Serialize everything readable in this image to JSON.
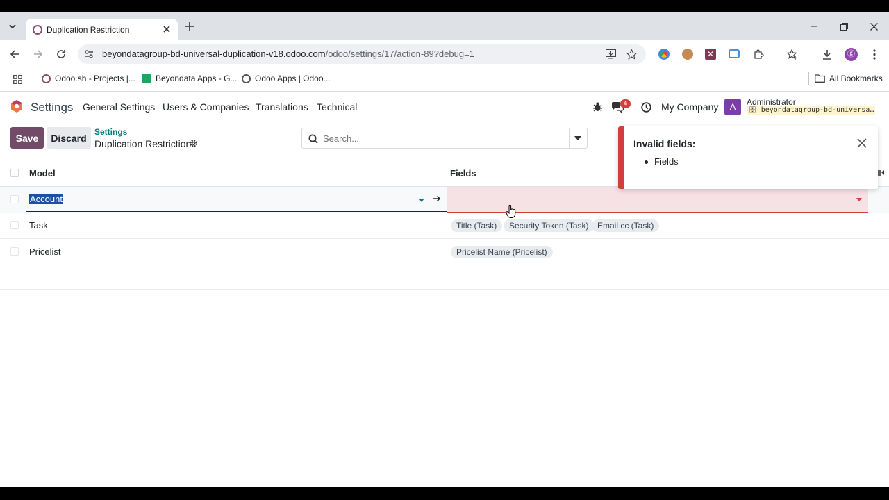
{
  "browser": {
    "tab_title": "Duplication Restriction",
    "url_host": "beyondatagroup-bd-universal-duplication-v18.odoo.com",
    "url_path": "/odoo/settings/17/action-89?debug=1",
    "bookmarks": [
      "Odoo.sh - Projects |...",
      "Beyondata Apps - G...",
      "Odoo Apps | Odoo..."
    ],
    "all_bookmarks": "All Bookmarks"
  },
  "navbar": {
    "app_name": "Settings",
    "menus": [
      "General Settings",
      "Users & Companies",
      "Translations",
      "Technical"
    ],
    "chat_count": "4",
    "company": "My Company",
    "avatar_letter": "A",
    "user_name": "Administrator",
    "db_name": "beyondatagroup-bd-universa…"
  },
  "control_panel": {
    "save_label": "Save",
    "discard_label": "Discard",
    "breadcrumb_parent": "Settings",
    "breadcrumb_current": "Duplication Restriction",
    "search_placeholder": "Search..."
  },
  "table": {
    "headers": [
      "Model",
      "Fields"
    ],
    "rows": [
      {
        "model": "Account",
        "fields": []
      },
      {
        "model": "Task",
        "fields": [
          "Title (Task)",
          "Security Token (Task)",
          "Email cc (Task)"
        ]
      },
      {
        "model": "Pricelist",
        "fields": [
          "Pricelist Name (Pricelist)"
        ]
      }
    ]
  },
  "toast": {
    "title": "Invalid fields:",
    "items": [
      "Fields"
    ]
  },
  "colors": {
    "brand": "#714b67",
    "teal": "#017e84",
    "danger": "#d23f3a",
    "invalid_bg": "#f6e1e4"
  }
}
